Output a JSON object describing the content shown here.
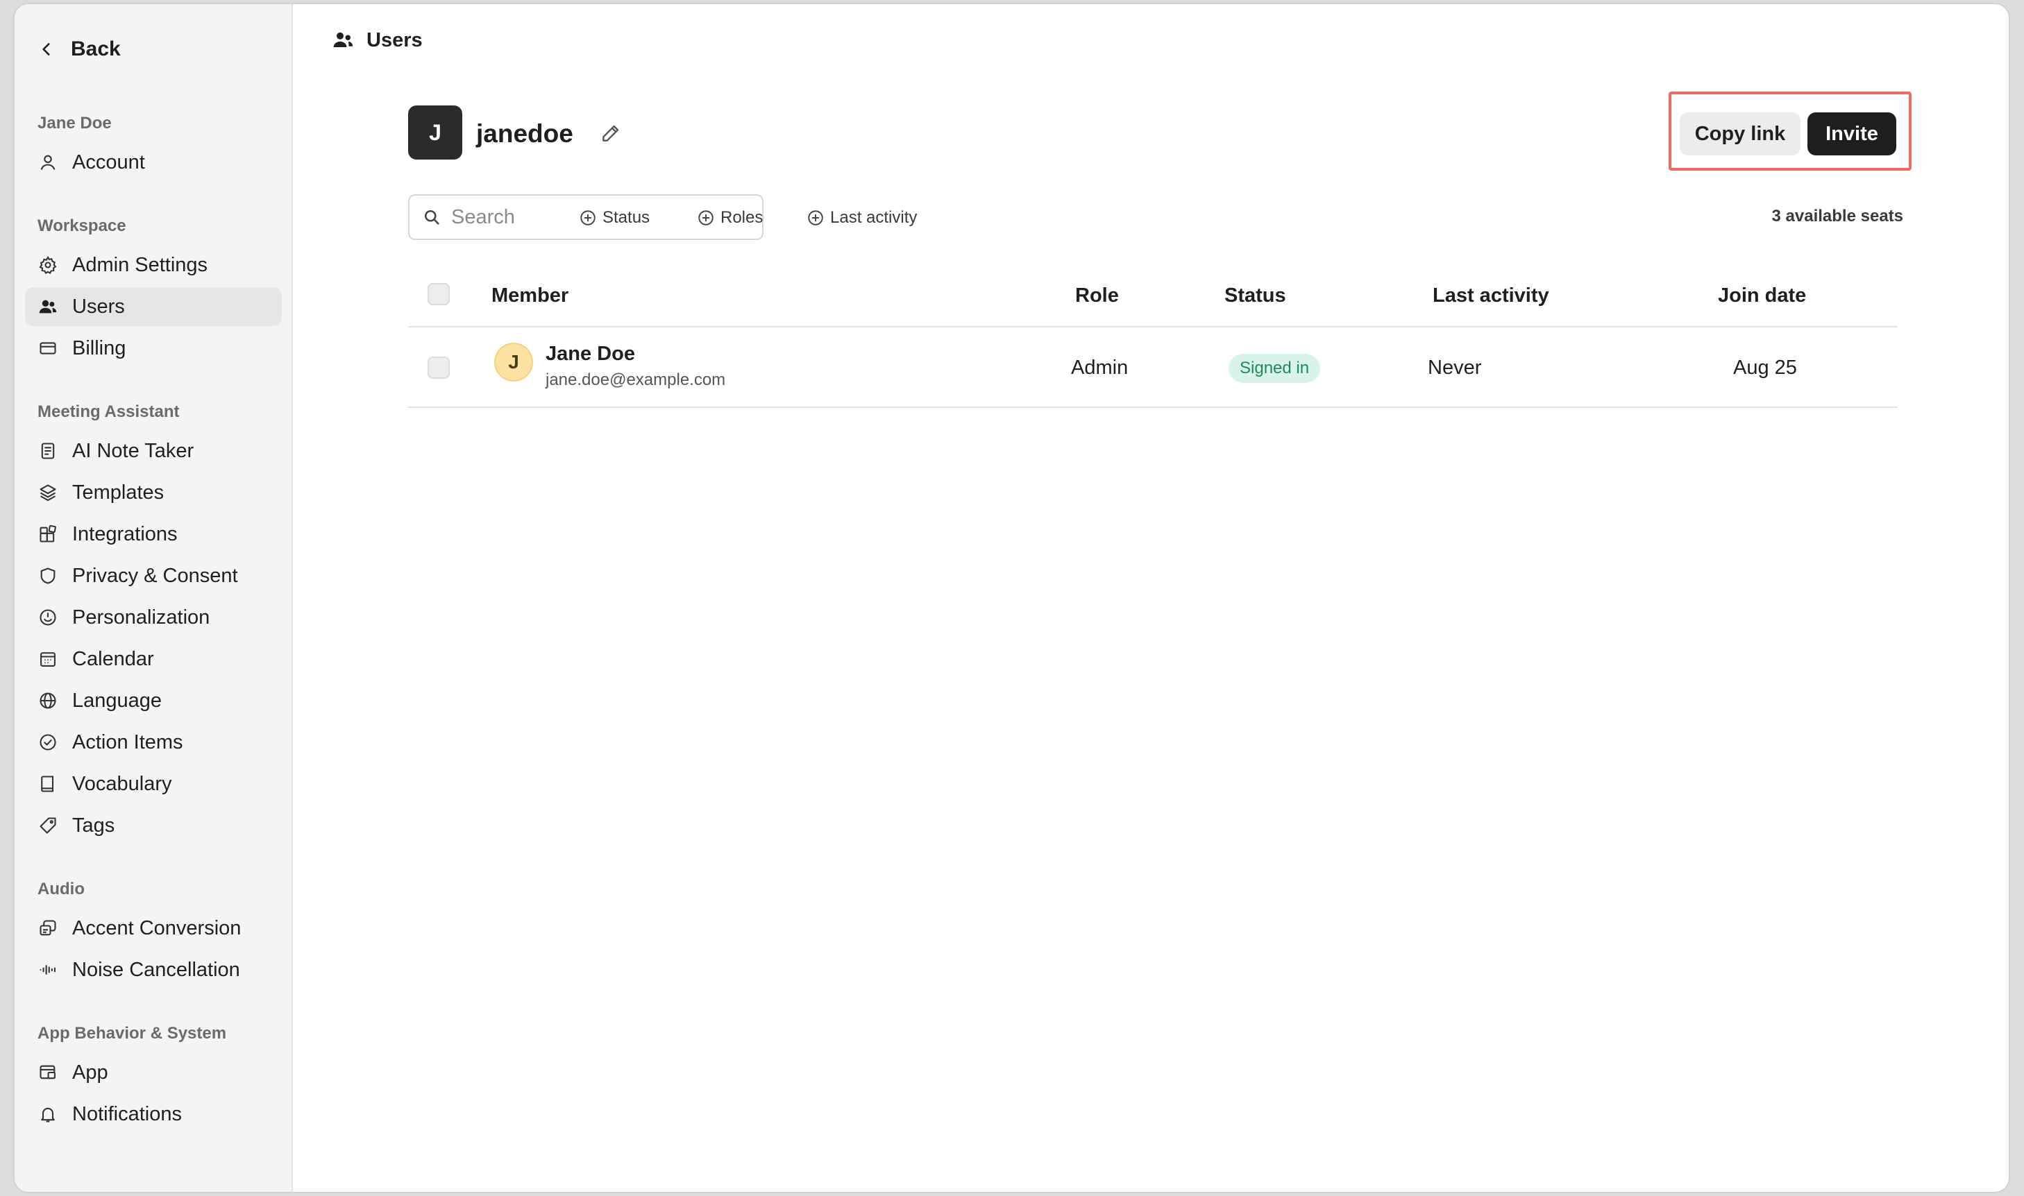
{
  "sidebar": {
    "back_label": "Back",
    "sections": [
      {
        "title": "Jane Doe",
        "items": [
          {
            "label": "Account",
            "icon": "user-icon"
          }
        ]
      },
      {
        "title": "Workspace",
        "items": [
          {
            "label": "Admin Settings",
            "icon": "gear-icon"
          },
          {
            "label": "Users",
            "icon": "users-icon",
            "active": true
          },
          {
            "label": "Billing",
            "icon": "credit-card-icon"
          }
        ]
      },
      {
        "title": "Meeting Assistant",
        "items": [
          {
            "label": "AI Note Taker",
            "icon": "note-icon"
          },
          {
            "label": "Templates",
            "icon": "layers-icon"
          },
          {
            "label": "Integrations",
            "icon": "puzzle-icon"
          },
          {
            "label": "Privacy & Consent",
            "icon": "shield-icon"
          },
          {
            "label": "Personalization",
            "icon": "smile-icon"
          },
          {
            "label": "Calendar",
            "icon": "calendar-icon"
          },
          {
            "label": "Language",
            "icon": "globe-icon"
          },
          {
            "label": "Action Items",
            "icon": "check-circle-icon"
          },
          {
            "label": "Vocabulary",
            "icon": "book-icon"
          },
          {
            "label": "Tags",
            "icon": "tag-icon"
          }
        ]
      },
      {
        "title": "Audio",
        "items": [
          {
            "label": "Accent Conversion",
            "icon": "accent-icon"
          },
          {
            "label": "Noise Cancellation",
            "icon": "waveform-icon"
          }
        ]
      },
      {
        "title": "App Behavior & System",
        "items": [
          {
            "label": "App",
            "icon": "app-window-icon"
          },
          {
            "label": "Notifications",
            "icon": "bell-icon"
          }
        ]
      }
    ]
  },
  "header": {
    "breadcrumb": "Users",
    "workspace_initial": "J",
    "workspace_name": "janedoe",
    "copy_link_label": "Copy link",
    "invite_label": "Invite"
  },
  "toolbar": {
    "search_placeholder": "Search",
    "filters": [
      "Status",
      "Roles",
      "Last activity"
    ],
    "seats_text": "3 available seats"
  },
  "table": {
    "columns": [
      "Member",
      "Role",
      "Status",
      "Last activity",
      "Join date"
    ],
    "rows": [
      {
        "initial": "J",
        "name": "Jane Doe",
        "email": "jane.doe@example.com",
        "role": "Admin",
        "status": "Signed in",
        "last_activity": "Never",
        "join_date": "Aug 25"
      }
    ]
  },
  "colors": {
    "accent_dark": "#1e1e1e",
    "status_badge_bg": "#d8f3ea",
    "status_badge_text": "#1f8a5c",
    "highlight_frame": "#ee6b63"
  }
}
